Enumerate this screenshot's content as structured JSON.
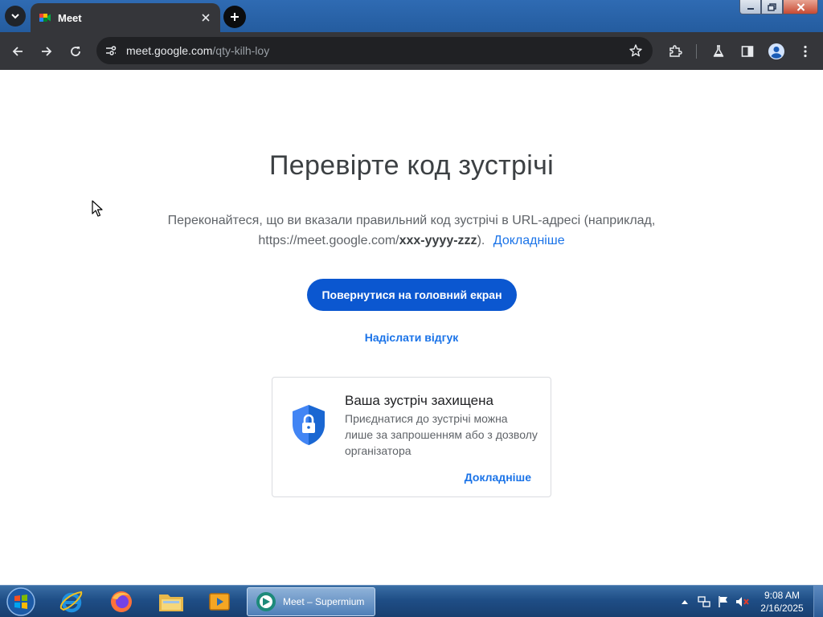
{
  "browser": {
    "tab_title": "Meet",
    "url_host": "meet.google.com",
    "url_path": "/qty-kilh-loy"
  },
  "page": {
    "headline": "Перевірте код зустрічі",
    "description_line1": "Переконайтеся, що ви вказали правильний код зустрічі в URL-адресі (наприклад,",
    "description_url_prefix": "https://meet.google.com/",
    "description_url_code": "xxx-yyyy-zzz",
    "description_url_suffix": ").",
    "description_link": "Докладніше",
    "primary_button": "Повернутися на головний екран",
    "feedback_link": "Надіслати відгук",
    "card": {
      "title": "Ваша зустріч захищена",
      "text": "Приєднатися до зустрічі можна лише за запрошенням або з дозволу організатора",
      "link": "Докладніше"
    }
  },
  "taskbar": {
    "active_task_label": "Meet – Supermium",
    "clock_time": "9:08 AM",
    "clock_date": "2/16/2025"
  },
  "colors": {
    "accent_blue": "#0b57d0",
    "link_blue": "#1a73e8",
    "browser_frame": "#35363a"
  }
}
